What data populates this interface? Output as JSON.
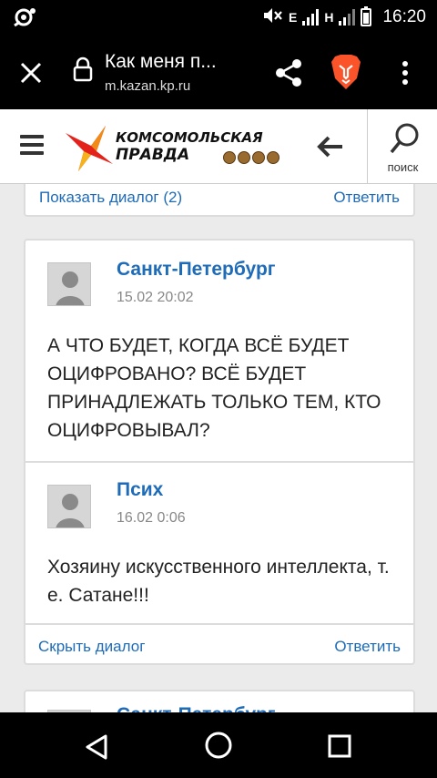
{
  "status_bar": {
    "time": "16:20",
    "network_1": "E",
    "network_2": "H",
    "icons": [
      "notification-icon",
      "mute-icon",
      "signal-icon",
      "battery-icon"
    ]
  },
  "browser": {
    "tab_title": "Как меня п...",
    "url": "m.kazan.kp.ru",
    "icons": [
      "close-icon",
      "lock-icon",
      "share-icon",
      "brave-lion-icon",
      "more-icon"
    ]
  },
  "site_header": {
    "logo_line1": "КОМСОМОЛЬСКАЯ",
    "logo_line2": "ПРАВДА",
    "search_label": "поиск",
    "icons": [
      "menu-icon",
      "back-arrow-icon",
      "search-icon"
    ]
  },
  "prev_card": {
    "show_dialog": "Показать диалог (2)",
    "reply": "Ответить"
  },
  "thread": {
    "comments": [
      {
        "author": "Санкт-Петербург",
        "date": "15.02 20:02",
        "text": "А ЧТО БУДЕТ, КОГДА ВСЁ БУДЕТ ОЦИФРОВАНО? ВСЁ БУДЕТ ПРИНАДЛЕЖАТЬ ТОЛЬКО ТЕМ, КТО ОЦИФРОВЫВАЛ?"
      },
      {
        "author": "Псих",
        "date": "16.02 0:06",
        "text": "Хозяину искусственного интеллекта, т. е. Сатане!!!"
      }
    ],
    "hide_dialog": "Скрыть диалог",
    "reply": "Ответить"
  },
  "next_card": {
    "author_partial": "Санкт-Петербург"
  },
  "colors": {
    "link": "#1e6bb8",
    "background": "#ebebeb",
    "brave": "#fb542b",
    "logo_red": "#e3231b"
  }
}
